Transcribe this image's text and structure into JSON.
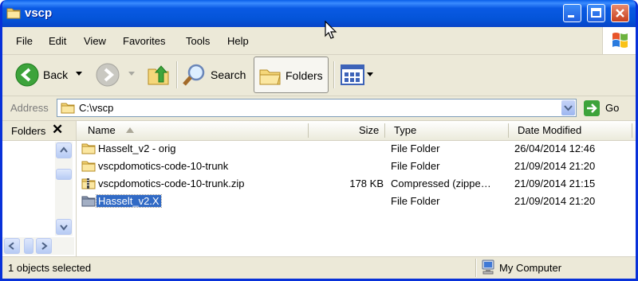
{
  "window": {
    "title": "vscp",
    "folder_icon": "folder-icon",
    "controls": [
      "minimize-icon",
      "maximize-icon",
      "close-icon"
    ]
  },
  "menu": {
    "items": [
      "File",
      "Edit",
      "View",
      "Favorites",
      "Tools",
      "Help"
    ]
  },
  "toolbar": {
    "back_label": "Back",
    "search_label": "Search",
    "folders_label": "Folders"
  },
  "address": {
    "label": "Address",
    "value": "C:\\vscp",
    "go_label": "Go"
  },
  "folders_pane": {
    "title": "Folders",
    "close_glyph": "✕"
  },
  "list": {
    "columns": [
      "Name",
      "Size",
      "Type",
      "Date Modified"
    ],
    "rows": [
      {
        "name": "Hasselt_v2 - orig",
        "size": "",
        "type": "File Folder",
        "date": "26/04/2014 12:46",
        "icon": "folder-icon"
      },
      {
        "name": "vscpdomotics-code-10-trunk",
        "size": "",
        "type": "File Folder",
        "date": "21/09/2014 21:20",
        "icon": "folder-icon"
      },
      {
        "name": "vscpdomotics-code-10-trunk.zip",
        "size": "178 KB",
        "type": "Compressed (zippe…",
        "date": "21/09/2014 21:15",
        "icon": "zip-folder-icon"
      },
      {
        "name": "Hasselt_v2.X",
        "size": "",
        "type": "File Folder",
        "date": "21/09/2014 21:20",
        "icon": "folder-icon",
        "selected": true
      }
    ]
  },
  "status": {
    "left": "1 objects selected",
    "right": "My Computer"
  },
  "colors": {
    "titlebar": "#0454D8",
    "selection": "#316AC5",
    "chrome": "#ECE9D8"
  }
}
